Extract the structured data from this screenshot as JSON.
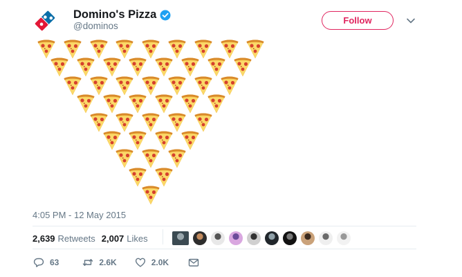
{
  "tweet": {
    "author": {
      "display_name": "Domino's Pizza",
      "handle": "@dominos",
      "verified": true,
      "avatar_icon": "dominos-logo-icon"
    },
    "follow_label": "Follow",
    "menu_icon": "chevron-down-icon",
    "media": {
      "emoji": "🍕",
      "emoji_name": "pizza-slice-icon",
      "rows": [
        9,
        8,
        7,
        6,
        5,
        4,
        3,
        2,
        1
      ]
    },
    "timestamp": "4:05 PM - 12 May 2015",
    "stats": {
      "retweets_count": "2,639",
      "retweets_label": "Retweets",
      "likes_count": "2,007",
      "likes_label": "Likes"
    },
    "likers": [
      "liker-1",
      "liker-2",
      "liker-3",
      "liker-4",
      "liker-5",
      "liker-6",
      "liker-7",
      "liker-8",
      "liker-9",
      "liker-10"
    ],
    "actions": {
      "reply_count": "63",
      "retweet_count": "2.6K",
      "like_count": "2.0K"
    },
    "colors": {
      "accent": "#e0245e",
      "verified": "#1da1f2",
      "muted": "#657786",
      "brand_red": "#e31837",
      "brand_blue": "#006491"
    }
  }
}
